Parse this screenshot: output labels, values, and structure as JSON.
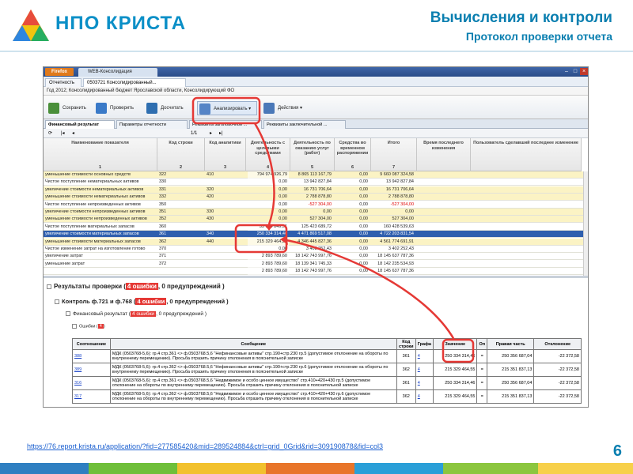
{
  "slide": {
    "logo_text": "НПО КРИСТА",
    "title": "Вычисления и контроли",
    "subtitle": "Протокол проверки отчета",
    "url": "https://76.report.krista.ru/application/?fid=277585420&mid=289524884&ctrl=grid_0Grid&rid=309190878&fid=col3",
    "page_number": "6"
  },
  "browser": {
    "firefox_label": "Firefox",
    "tab_title": "WEB-Консолидация"
  },
  "app": {
    "tabs": [
      {
        "label": "Отчетность"
      },
      {
        "label": "0503721 Консолидированный..."
      }
    ],
    "info_line": "Год 2012; Консолидированный бюджет Ярославской области, Консолидирующий ФО",
    "toolbar": {
      "save": "Сохранить",
      "check": "Проверить",
      "calc": "Досчитать",
      "analyze": "Анализировать",
      "actions": "Действия"
    },
    "subtabs": [
      "Финансовый результат",
      "Параметры отчетности",
      "Реквизиты заголовочной ...",
      "Реквизиты заключительной ..."
    ],
    "pager": "1/1"
  },
  "grid": {
    "headers": [
      "Наименование показателя",
      "Код строки",
      "Код аналитики",
      "Деятельность с целевыми средствами",
      "Деятельность по оказанию услуг (работ)",
      "Средства во временном распоряжении",
      "Итого",
      "Время последнего изменения",
      "Пользователь сделавший последнее изменение"
    ],
    "col_numbers": [
      "1",
      "2",
      "3",
      "4",
      "5",
      "6",
      "7",
      "",
      ""
    ],
    "rows": [
      {
        "name": "уменьшение стоимости основных средств",
        "code": "322",
        "an": "410",
        "c4": "794 974 926,79",
        "c5": "8 865 113 167,79",
        "c6": "0,00",
        "total": "9 660 087 324,58",
        "hl": "y"
      },
      {
        "name": "Чистое поступление нематериальных активов",
        "code": "330",
        "an": "",
        "c4": "0,00",
        "c5": "13 942 827,84",
        "c6": "0,00",
        "total": "13 942 827,84",
        "hl": "w"
      },
      {
        "name": "увеличение стоимости нематериальных активов",
        "code": "331",
        "an": "320",
        "c4": "0,00",
        "c5": "16 731 706,64",
        "c6": "0,00",
        "total": "16 731 706,64",
        "hl": "y"
      },
      {
        "name": "уменьшение стоимости нематериальных активов",
        "code": "332",
        "an": "420",
        "c4": "0,00",
        "c5": "2 788 878,80",
        "c6": "0,00",
        "total": "2 788 878,80",
        "hl": "y"
      },
      {
        "name": "Чистое поступление непроизведенных активов",
        "code": "350",
        "an": "",
        "c4": "0,00",
        "c5": "-527 304,00",
        "c6": "0,00",
        "total": "-527 304,00",
        "hl": "w",
        "red": true
      },
      {
        "name": "увеличение стоимости непроизведенных активов",
        "code": "351",
        "an": "330",
        "c4": "0,00",
        "c5": "0,00",
        "c6": "0,00",
        "total": "0,00",
        "hl": "y"
      },
      {
        "name": "уменьшение стоимости непроизведенных активов",
        "code": "352",
        "an": "430",
        "c4": "0,00",
        "c5": "527 304,00",
        "c6": "0,00",
        "total": "527 304,00",
        "hl": "y"
      },
      {
        "name": "Чистое поступление материальных запасов",
        "code": "360",
        "an": "",
        "c4": "35 004 849,91",
        "c5": "125 423 689,72",
        "c6": "0,00",
        "total": "160 428 539,63",
        "hl": "w"
      },
      {
        "name": "увеличение стоимости материальных запасов",
        "code": "361",
        "an": "340",
        "c4": "250 334 314,46",
        "c5": "4 471 869 517,08",
        "c6": "0,00",
        "total": "4 722 203 831,54",
        "hl": "sel"
      },
      {
        "name": "уменьшение стоимости материальных запасов",
        "code": "362",
        "an": "440",
        "c4": "215 329 464,55",
        "c5": "4 346 445 827,36",
        "c6": "0,00",
        "total": "4 561 774 691,91",
        "hl": "y"
      },
      {
        "name": "Чистое изменение затрат на изготовление готово",
        "code": "370",
        "an": "",
        "c4": "0,00",
        "c5": "3 402 252,43",
        "c6": "0,00",
        "total": "3 402 252,43",
        "hl": "w"
      },
      {
        "name": "увеличение затрат",
        "code": "371",
        "an": "",
        "c4": "2 893 789,60",
        "c5": "18 142 743 997,76",
        "c6": "0,00",
        "total": "18 145 637 787,36",
        "hl": "w"
      },
      {
        "name": "уменьшение затрат",
        "code": "372",
        "an": "",
        "c4": "2 893 789,60",
        "c5": "18 139 341 745,33",
        "c6": "0,00",
        "total": "18 142 235 534,93",
        "hl": "w"
      },
      {
        "name": "",
        "code": "",
        "an": "",
        "c4": "2 893 789,60",
        "c5": "18 142 743 997,76",
        "c6": "0,00",
        "total": "18 145 637 787,36",
        "hl": "w"
      }
    ]
  },
  "results": {
    "header_pre": "Результаты проверки (",
    "header_err": "4 ошибки",
    "header_post": ", 0 предупреждений )",
    "control_pre": "Контроль ф.721 и ф.768 (",
    "control_err": "4 ошибки",
    "control_post": ", 0 предупреждений )",
    "fin_pre": "Финансовый результат (",
    "fin_err": "4 ошибки",
    "fin_post": ", 0 предупреждений )",
    "errors_pre": "Ошибки (",
    "errors_err": "4",
    "errors_post": ")",
    "table_headers": [
      "Соотношение",
      "Сообщение",
      "Код строки",
      "Графа",
      "Значение",
      "Оп",
      "Правая часть",
      "Отклонение"
    ],
    "table_rows": [
      {
        "id": "388",
        "msg": "МДК (0503768-5,6): гр.4 стр.361 <> ф.0503768.5,6 \"Нефинансовые активы\" стр.190+стр.230 гр.5 (допустимое отклонение на обороты по внутреннему перемещению). Просьба отразить причину отклонения в пояснительной записке",
        "code": "361",
        "col": "4",
        "val": "250 334 314,46",
        "op": "=",
        "right": "250 356 687,04",
        "dev": "-22 372,58"
      },
      {
        "id": "389",
        "msg": "МДК (0503768-5,6): гр.4 стр.362 <> ф.0503768.5,6 \"Нефинансовые активы\" стр.190+стр.230 гр.6 (допустимое отклонение на обороты по внутреннему перемещению). Просьба отразить причину отклонения в пояснительной записке",
        "code": "362",
        "col": "4",
        "val": "215 329 464,55",
        "op": "=",
        "right": "215 351 837,13",
        "dev": "-22 372,58"
      },
      {
        "id": "316",
        "msg": "МДК (0503768-5,6): гр.4 стр.361 <> ф.0503768.5,6 \"Недвижимое и особо ценное имущество\" стр.410+420+430 гр.5 (допустимое отклонение на обороты по внутреннему перемещению). Просьба отразить причину отклонения в пояснительной записке",
        "code": "361",
        "col": "4",
        "val": "250 334 314,46",
        "op": "=",
        "right": "250 356 687,04",
        "dev": "-22 372,58"
      },
      {
        "id": "317",
        "msg": "МДК (0503768-5,6): гр.4 стр.362 <> ф.0503768.5,6 \"Недвижимое и особо ценное имущество\" стр.410+420+430 гр.6 (допустимое отклонение на обороты по внутреннему перемещению). Просьба отразить причину отклонения в пояснительной записке",
        "code": "362",
        "col": "4",
        "val": "215 329 464,55",
        "op": "=",
        "right": "215 351 837,13",
        "dev": "-22 372,58"
      }
    ]
  },
  "colors": {
    "accent": "#0a7fb0",
    "highlight_red": "#e53935",
    "row_yellow": "#fbf3c4",
    "row_selected": "#2f5fae"
  },
  "icons": {
    "logo": "krista-triangle-logo",
    "save": "save-icon",
    "check": "check-icon",
    "calc": "calc-icon",
    "analyze": "analyze-icon",
    "actions": "actions-icon"
  }
}
